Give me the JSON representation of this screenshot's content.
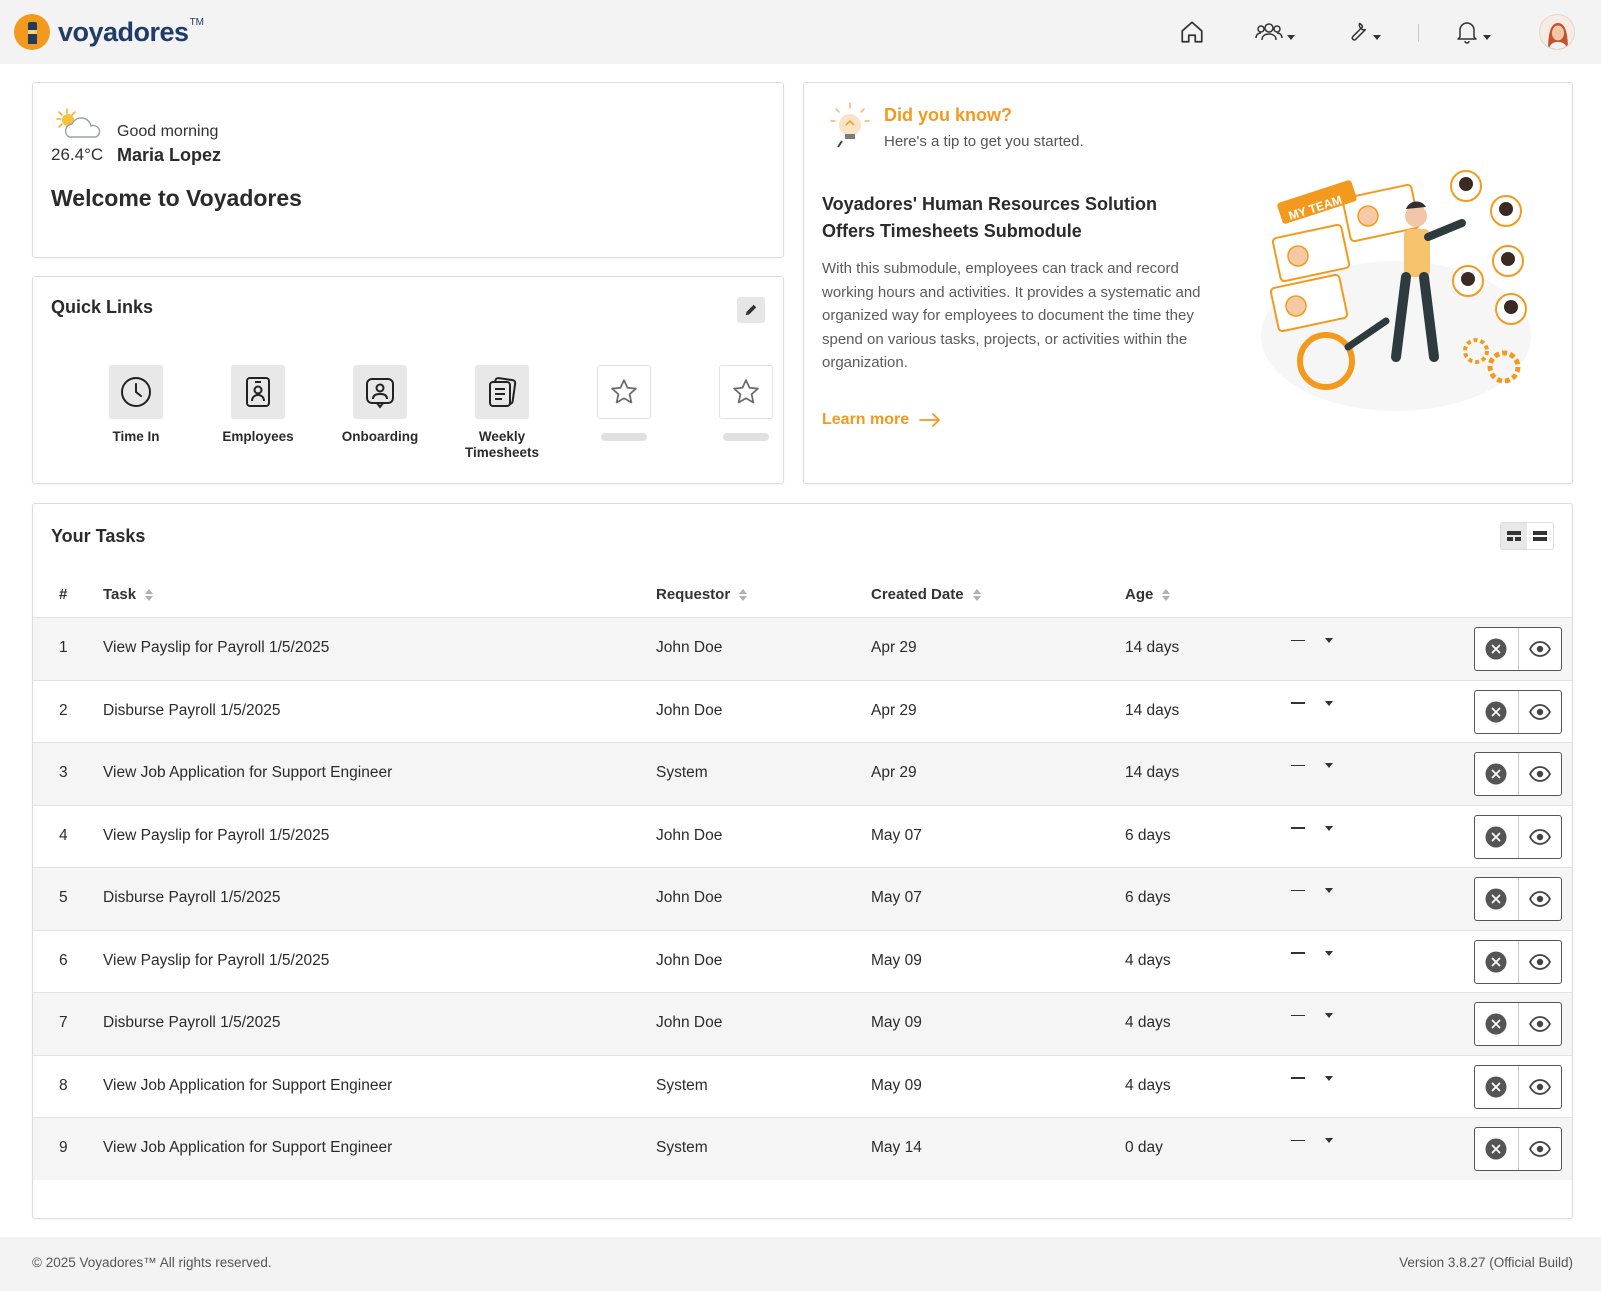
{
  "app": {
    "brand": "voyadores",
    "tm": "TM",
    "accent": "#f39a1e",
    "brand_color": "#1f3d66"
  },
  "header": {
    "icons": [
      "home-icon",
      "team-icon",
      "tools-icon",
      "bell-icon"
    ]
  },
  "welcome": {
    "greeting": "Good morning",
    "temperature": "26.4°C",
    "user_name": "Maria Lopez",
    "title": "Welcome to Voyadores"
  },
  "quick_links": {
    "title": "Quick Links",
    "items": [
      {
        "label": "Time In",
        "icon": "clock-icon"
      },
      {
        "label": "Employees",
        "icon": "employee-badge-icon"
      },
      {
        "label": "Onboarding",
        "icon": "onboarding-icon"
      },
      {
        "label": "Weekly Timesheets",
        "icon": "timesheet-icon"
      },
      {
        "label": "",
        "icon": "star-icon"
      },
      {
        "label": "",
        "icon": "star-icon"
      }
    ]
  },
  "tip": {
    "heading": "Did you know?",
    "subheading": "Here's a tip to get you started.",
    "title": "Voyadores' Human Resources Solution Offers Timesheets Submodule",
    "body": "With this submodule, employees can track and record working hours and activities. It provides a systematic and organized way for employees to document the time they spend on various tasks, projects, or activities within the organization.",
    "link": "Learn more",
    "illustration_label": "MY TEAM"
  },
  "tasks": {
    "title": "Your Tasks",
    "columns": {
      "num": "#",
      "task": "Task",
      "requestor": "Requestor",
      "created": "Created Date",
      "age": "Age"
    },
    "rows": [
      {
        "num": "1",
        "task": "View Payslip for Payroll 1/5/2025",
        "requestor": "John Doe",
        "created": "Apr 29",
        "age": "14 days",
        "priority": "—"
      },
      {
        "num": "2",
        "task": "Disburse Payroll 1/5/2025",
        "requestor": "John Doe",
        "created": "Apr 29",
        "age": "14 days",
        "priority": "—"
      },
      {
        "num": "3",
        "task": "View Job Application for Support Engineer",
        "requestor": "System",
        "created": "Apr 29",
        "age": "14 days",
        "priority": "—"
      },
      {
        "num": "4",
        "task": "View Payslip for Payroll 1/5/2025",
        "requestor": "John Doe",
        "created": "May 07",
        "age": "6 days",
        "priority": "—"
      },
      {
        "num": "5",
        "task": "Disburse Payroll 1/5/2025",
        "requestor": "John Doe",
        "created": "May 07",
        "age": "6 days",
        "priority": "—"
      },
      {
        "num": "6",
        "task": "View Payslip for Payroll 1/5/2025",
        "requestor": "John Doe",
        "created": "May 09",
        "age": "4 days",
        "priority": "—"
      },
      {
        "num": "7",
        "task": "Disburse Payroll 1/5/2025",
        "requestor": "John Doe",
        "created": "May 09",
        "age": "4 days",
        "priority": "—"
      },
      {
        "num": "8",
        "task": "View Job Application for Support Engineer",
        "requestor": "System",
        "created": "May 09",
        "age": "4 days",
        "priority": "—"
      },
      {
        "num": "9",
        "task": "View Job Application for Support Engineer",
        "requestor": "System",
        "created": "May 14",
        "age": "0 day",
        "priority": "—"
      }
    ]
  },
  "footer": {
    "copyright": "© 2025 Voyadores™ All rights reserved.",
    "version": "Version 3.8.27 (Official Build)"
  }
}
